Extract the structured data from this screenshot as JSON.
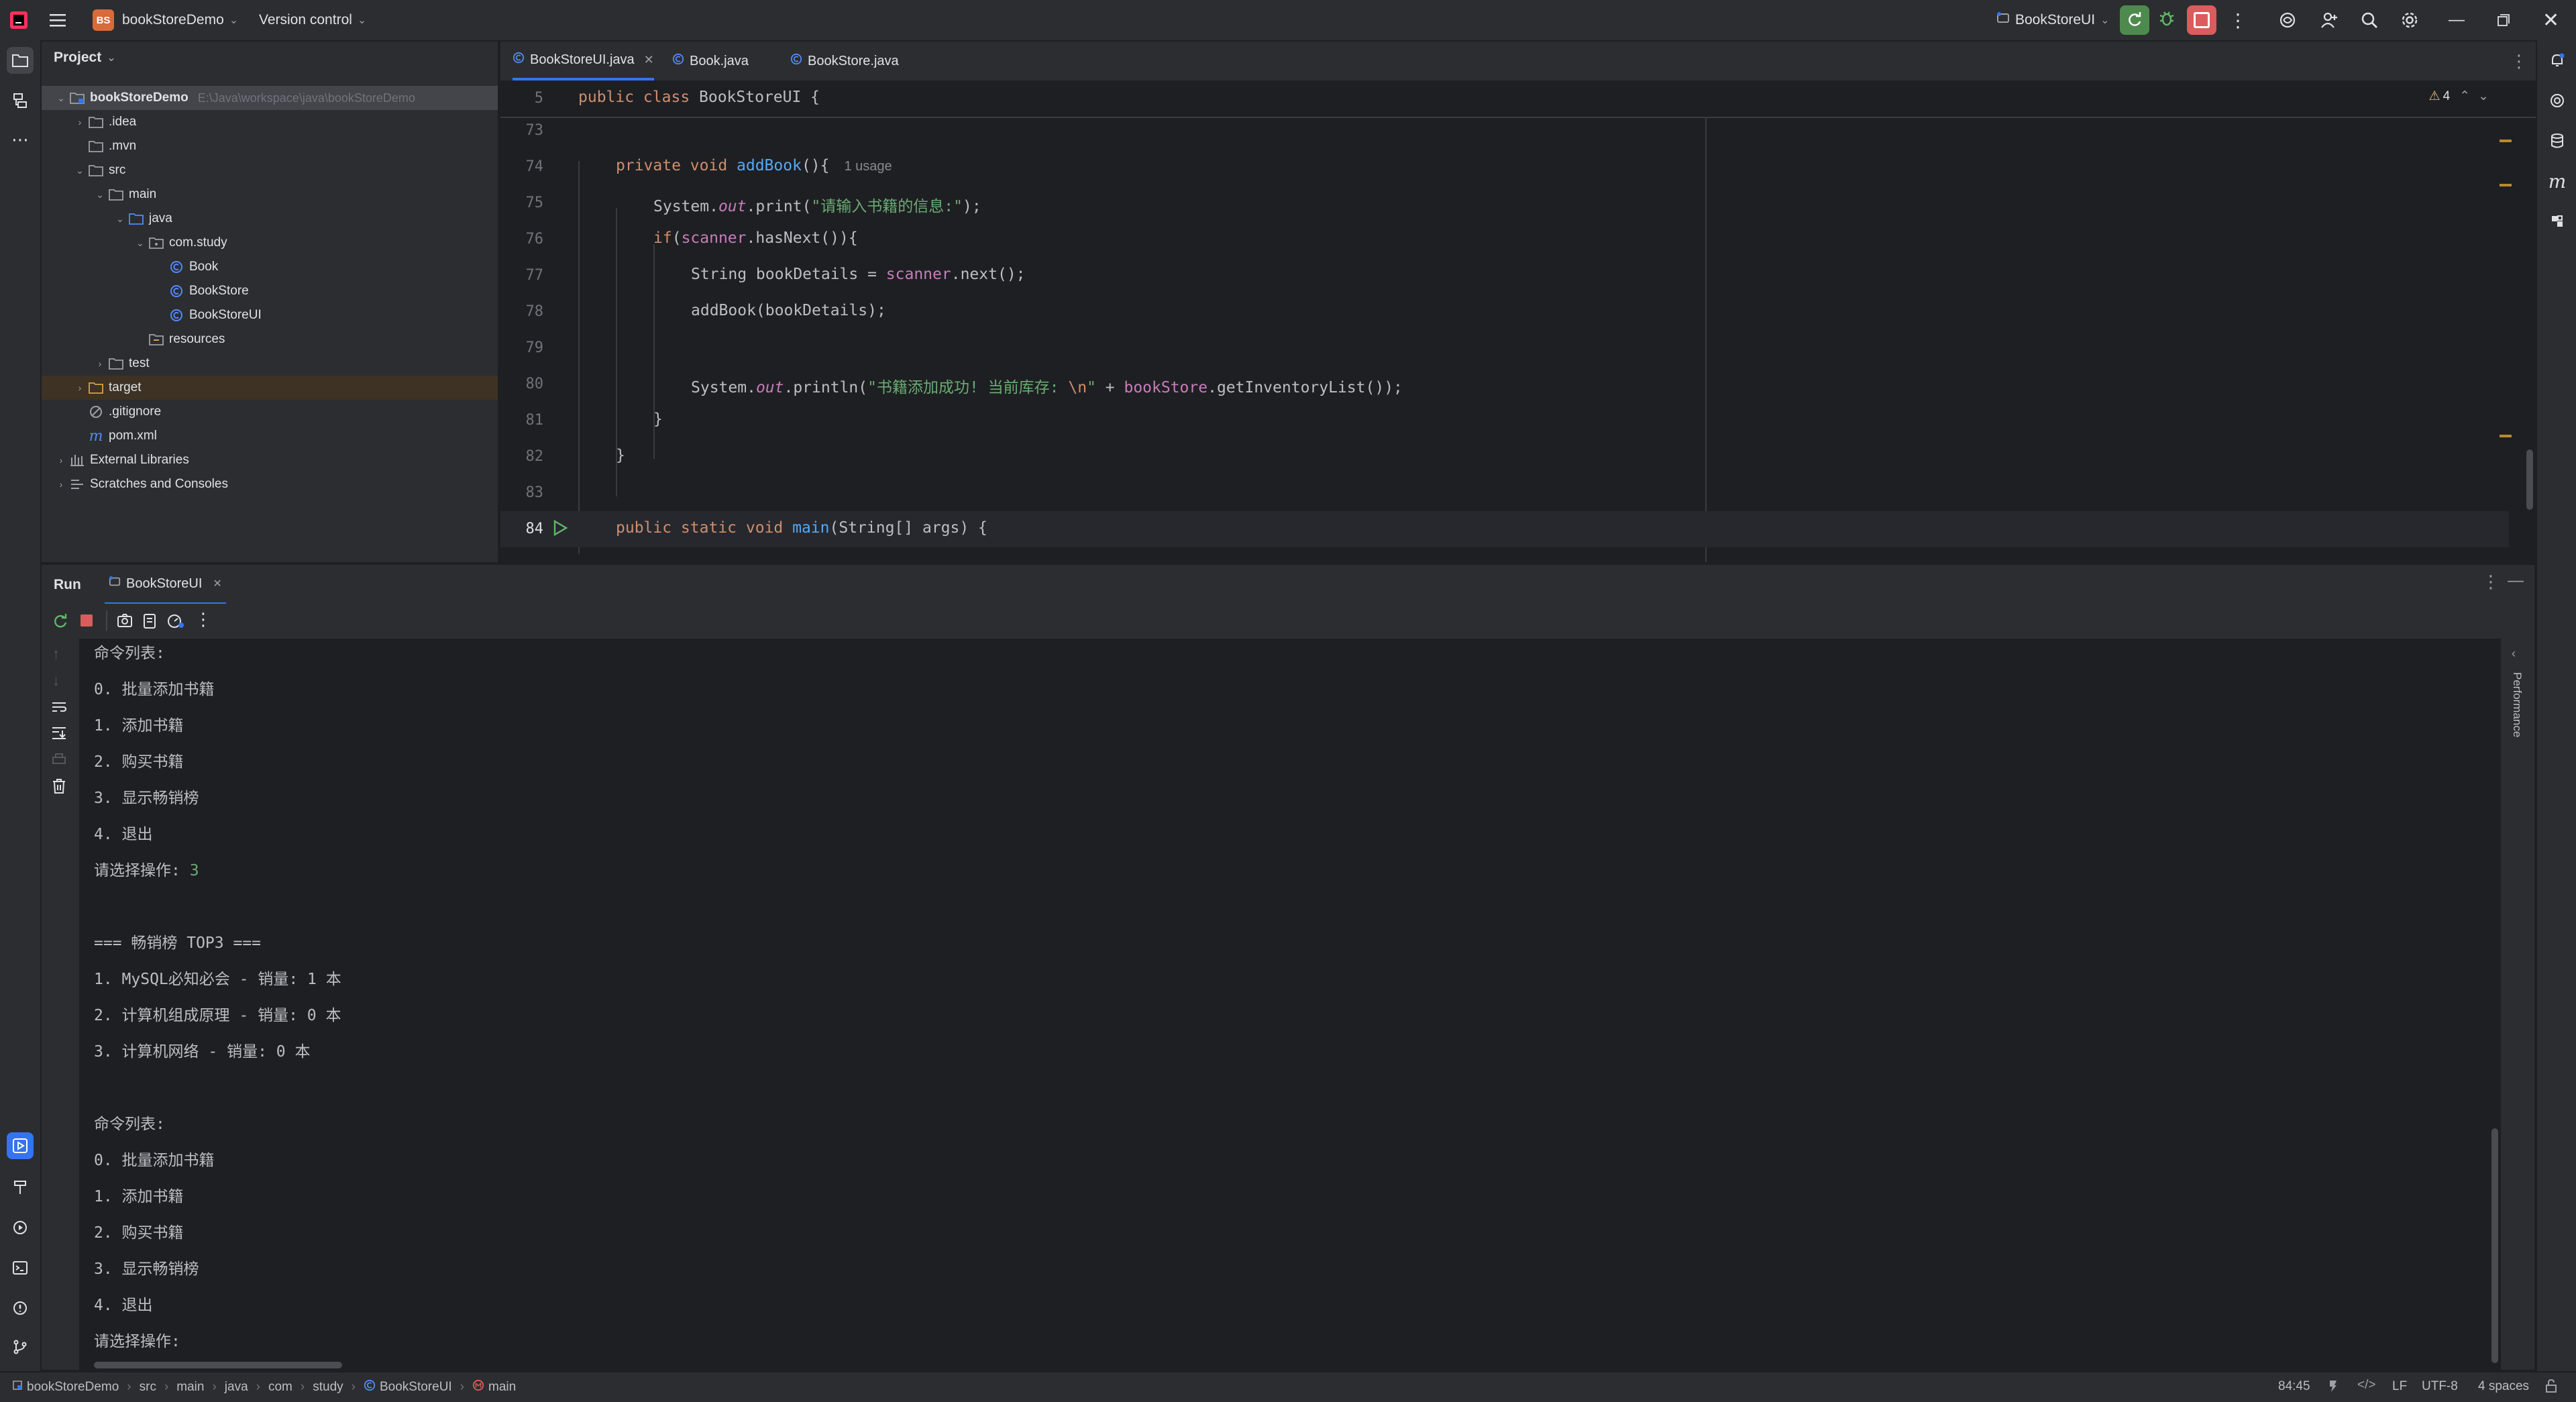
{
  "titlebar": {
    "project_badge": "BS",
    "project_name": "bookStoreDemo",
    "vcs": "Version control",
    "run_config": "BookStoreUI"
  },
  "project_panel": {
    "header": "Project",
    "root": {
      "label": "bookStoreDemo",
      "path": "E:\\Java\\workspace\\java\\bookStoreDemo"
    },
    "items": [
      {
        "label": ".idea"
      },
      {
        "label": ".mvn"
      },
      {
        "label": "src"
      },
      {
        "label": "main"
      },
      {
        "label": "java"
      },
      {
        "label": "com.study"
      },
      {
        "label": "Book"
      },
      {
        "label": "BookStore"
      },
      {
        "label": "BookStoreUI"
      },
      {
        "label": "resources"
      },
      {
        "label": "test"
      },
      {
        "label": "target"
      },
      {
        "label": ".gitignore"
      },
      {
        "label": "pom.xml"
      },
      {
        "label": "External Libraries"
      },
      {
        "label": "Scratches and Consoles"
      }
    ]
  },
  "editor": {
    "tabs": [
      "BookStoreUI.java",
      "Book.java",
      "BookStore.java"
    ],
    "warnings": "4",
    "sticky_line": "5",
    "sticky_code": "public class BookStoreUI {",
    "line_numbers": [
      "73",
      "74",
      "75",
      "76",
      "77",
      "78",
      "79",
      "80",
      "81",
      "82",
      "83",
      "84"
    ],
    "usage_hint": "1 usage"
  },
  "run_panel": {
    "title": "Run",
    "tab": "BookStoreUI",
    "side_label": "Performance",
    "lines": [
      "命令列表:",
      "0. 批量添加书籍",
      "1. 添加书籍",
      "2. 购买书籍",
      "3. 显示畅销榜",
      "4. 退出",
      "请选择操作: ",
      "3",
      "",
      "=== 畅销榜 TOP3 ===",
      "1. MySQL必知必会 - 销量: 1 本",
      "2. 计算机组成原理 - 销量: 0 本",
      "3. 计算机网络 - 销量: 0 本",
      "",
      "命令列表:",
      "0. 批量添加书籍",
      "1. 添加书籍",
      "2. 购买书籍",
      "3. 显示畅销榜",
      "4. 退出",
      "请选择操作:"
    ]
  },
  "statusbar": {
    "breadcrumbs": [
      "bookStoreDemo",
      "src",
      "main",
      "java",
      "com",
      "study",
      "BookStoreUI",
      "main"
    ],
    "position": "84:45",
    "line_sep": "LF",
    "encoding": "UTF-8",
    "indent": "4 spaces"
  },
  "colors": {
    "accent": "#3574f0",
    "keyword": "#cf8e6d",
    "string": "#6aab73",
    "function": "#56a8f5",
    "field": "#c77dbb"
  }
}
